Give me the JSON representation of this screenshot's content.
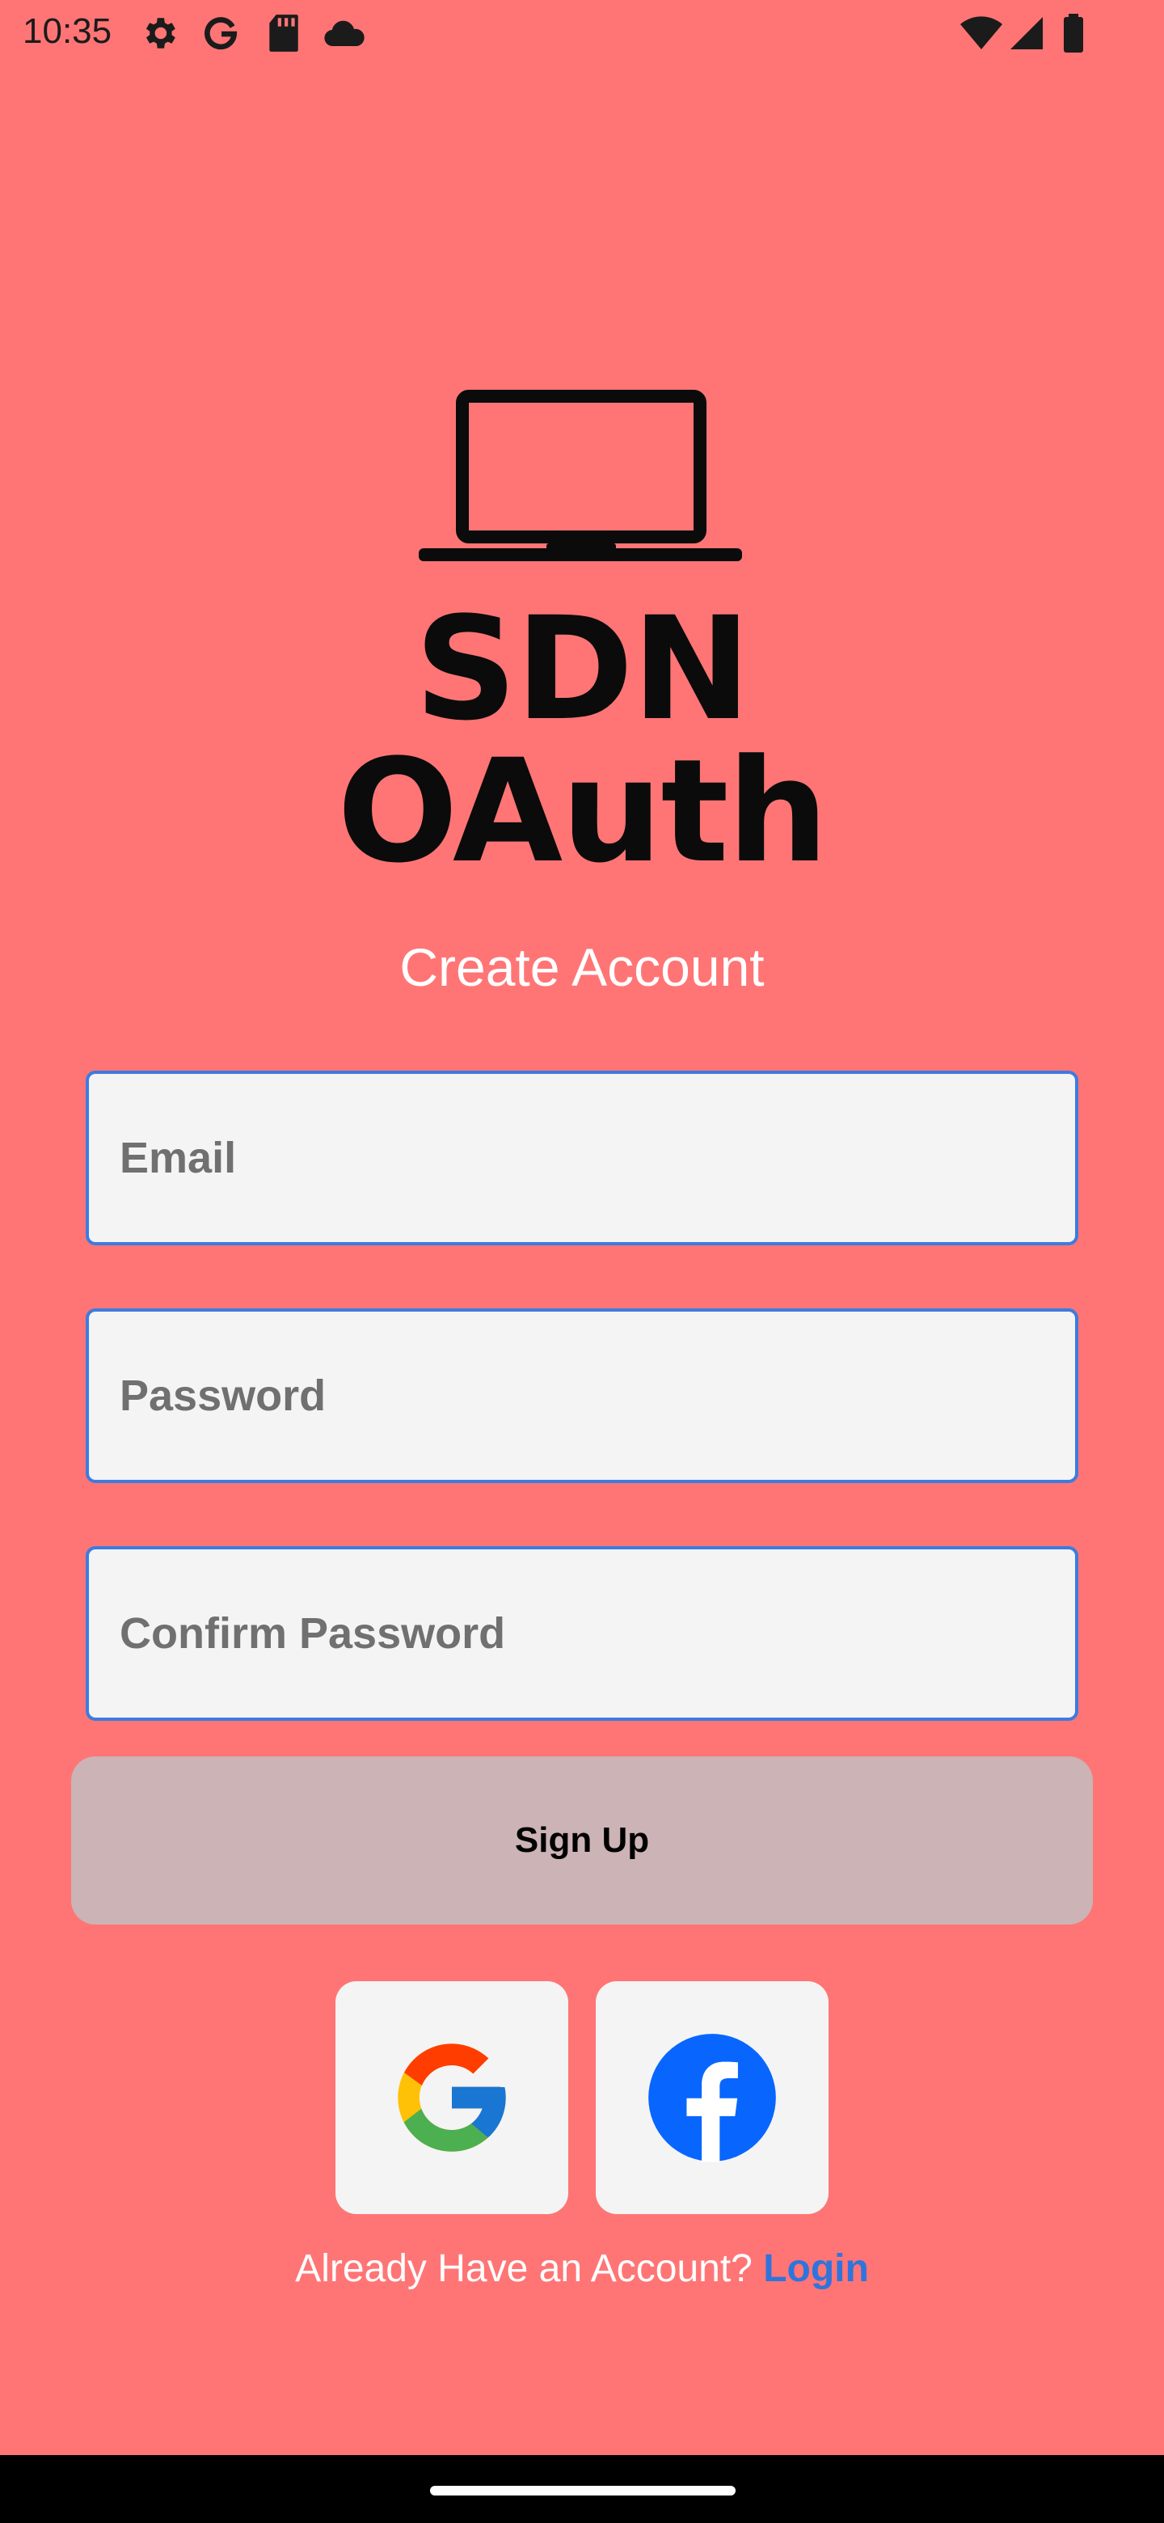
{
  "status_bar": {
    "time": "10:35",
    "left_icons": [
      "settings-icon",
      "google-icon",
      "sd-card-icon",
      "cloud-icon"
    ],
    "right_icons": [
      "wifi-icon",
      "signal-icon",
      "battery-icon"
    ]
  },
  "logo": {
    "text": "SDN OAuth",
    "icon": "laptop-icon"
  },
  "form": {
    "heading": "Create Account",
    "email_placeholder": "Email",
    "password_placeholder": "Password",
    "confirm_password_placeholder": "Confirm Password",
    "signup_label": "Sign Up"
  },
  "social": {
    "buttons": [
      "google-icon",
      "facebook-icon"
    ]
  },
  "footer": {
    "prompt": "Already Have an Account?",
    "login_label": "Login"
  },
  "colors": {
    "background": "#FF7575",
    "field_border": "#3D7BE0",
    "signup_button": "#CCB3B5",
    "link": "#2F74DC",
    "facebook": "#0866FF"
  }
}
